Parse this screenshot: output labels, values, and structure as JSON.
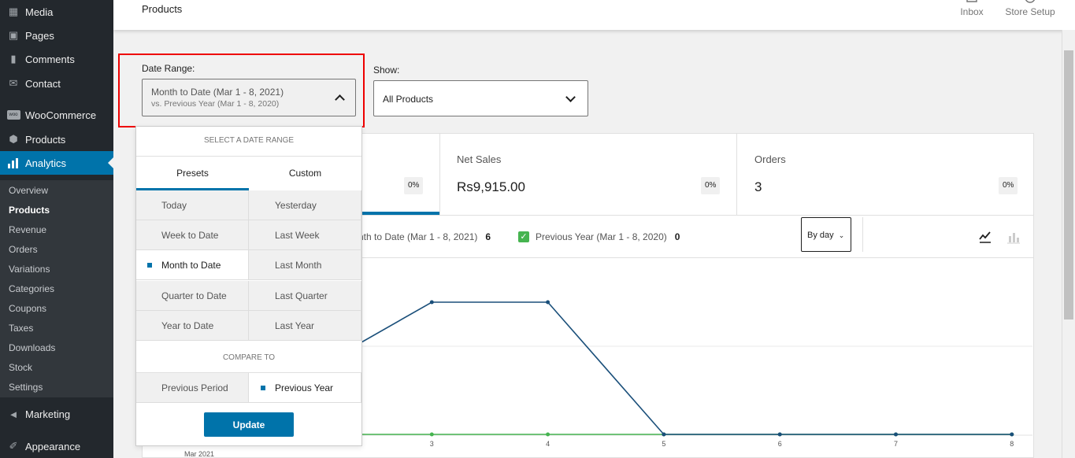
{
  "sidebar": {
    "items": [
      {
        "label": "Media",
        "icon": "media-icon"
      },
      {
        "label": "Pages",
        "icon": "pages-icon"
      },
      {
        "label": "Comments",
        "icon": "comments-icon"
      },
      {
        "label": "Contact",
        "icon": "mail-icon"
      },
      {
        "label": "WooCommerce",
        "icon": "woo-icon"
      },
      {
        "label": "Products",
        "icon": "products-icon"
      },
      {
        "label": "Analytics",
        "icon": "analytics-icon"
      },
      {
        "label": "Marketing",
        "icon": "megaphone-icon"
      },
      {
        "label": "Appearance",
        "icon": "brush-icon"
      }
    ],
    "submenu": [
      "Overview",
      "Products",
      "Revenue",
      "Orders",
      "Variations",
      "Categories",
      "Coupons",
      "Taxes",
      "Downloads",
      "Stock",
      "Settings"
    ],
    "current_submenu": "Products"
  },
  "header": {
    "title": "Products",
    "inbox_label": "Inbox",
    "store_setup_label": "Store Setup"
  },
  "filters": {
    "date_range_label": "Date Range:",
    "date_primary": "Month to Date (Mar 1 - 8, 2021)",
    "date_secondary": "vs. Previous Year (Mar 1 - 8, 2020)",
    "show_label": "Show:",
    "show_value": "All Products"
  },
  "dropdown": {
    "heading": "SELECT A DATE RANGE",
    "tabs": [
      "Presets",
      "Custom"
    ],
    "presets": [
      [
        "Today",
        "Yesterday"
      ],
      [
        "Week to Date",
        "Last Week"
      ],
      [
        "Month to Date",
        "Last Month"
      ],
      [
        "Quarter to Date",
        "Last Quarter"
      ],
      [
        "Year to Date",
        "Last Year"
      ]
    ],
    "selected_preset": "Month to Date",
    "compare_heading": "COMPARE TO",
    "compare": [
      "Previous Period",
      "Previous Year"
    ],
    "selected_compare": "Previous Year",
    "update_label": "Update"
  },
  "summary": {
    "cards": [
      {
        "label": "",
        "value": "",
        "delta": "0%"
      },
      {
        "label": "Net Sales",
        "value": "Rs9,915.00",
        "delta": "0%"
      },
      {
        "label": "Orders",
        "value": "3",
        "delta": "0%"
      }
    ]
  },
  "chart_controls": {
    "legend": [
      {
        "label": "nth to Date (Mar 1 - 8, 2021)",
        "count": "6",
        "color": "#1a4f7a"
      },
      {
        "label": "Previous Year (Mar 1 - 8, 2020)",
        "count": "0",
        "color": "#46b450"
      }
    ],
    "interval": "By day"
  },
  "chart_data": {
    "type": "line",
    "x": [
      2,
      3,
      4,
      5,
      6,
      7,
      8
    ],
    "x_tick_labels": [
      "3",
      "4",
      "5",
      "6",
      "7",
      "8"
    ],
    "x_first_label": "Mar 2021",
    "series": [
      {
        "name": "Month to Date (Mar 1 - 8, 2021)",
        "color": "#1a4f7a",
        "values": [
          1,
          2,
          2,
          0,
          0,
          0,
          0
        ]
      },
      {
        "name": "Previous Year (Mar 1 - 8, 2020)",
        "color": "#46b450",
        "values": [
          0,
          0,
          0,
          0,
          0,
          0,
          0
        ]
      }
    ],
    "ylim": [
      0,
      2.4
    ],
    "grid": true
  },
  "colors": {
    "accent": "#0073aa",
    "sidebar_bg": "#23282d",
    "highlight": "#e00000"
  }
}
